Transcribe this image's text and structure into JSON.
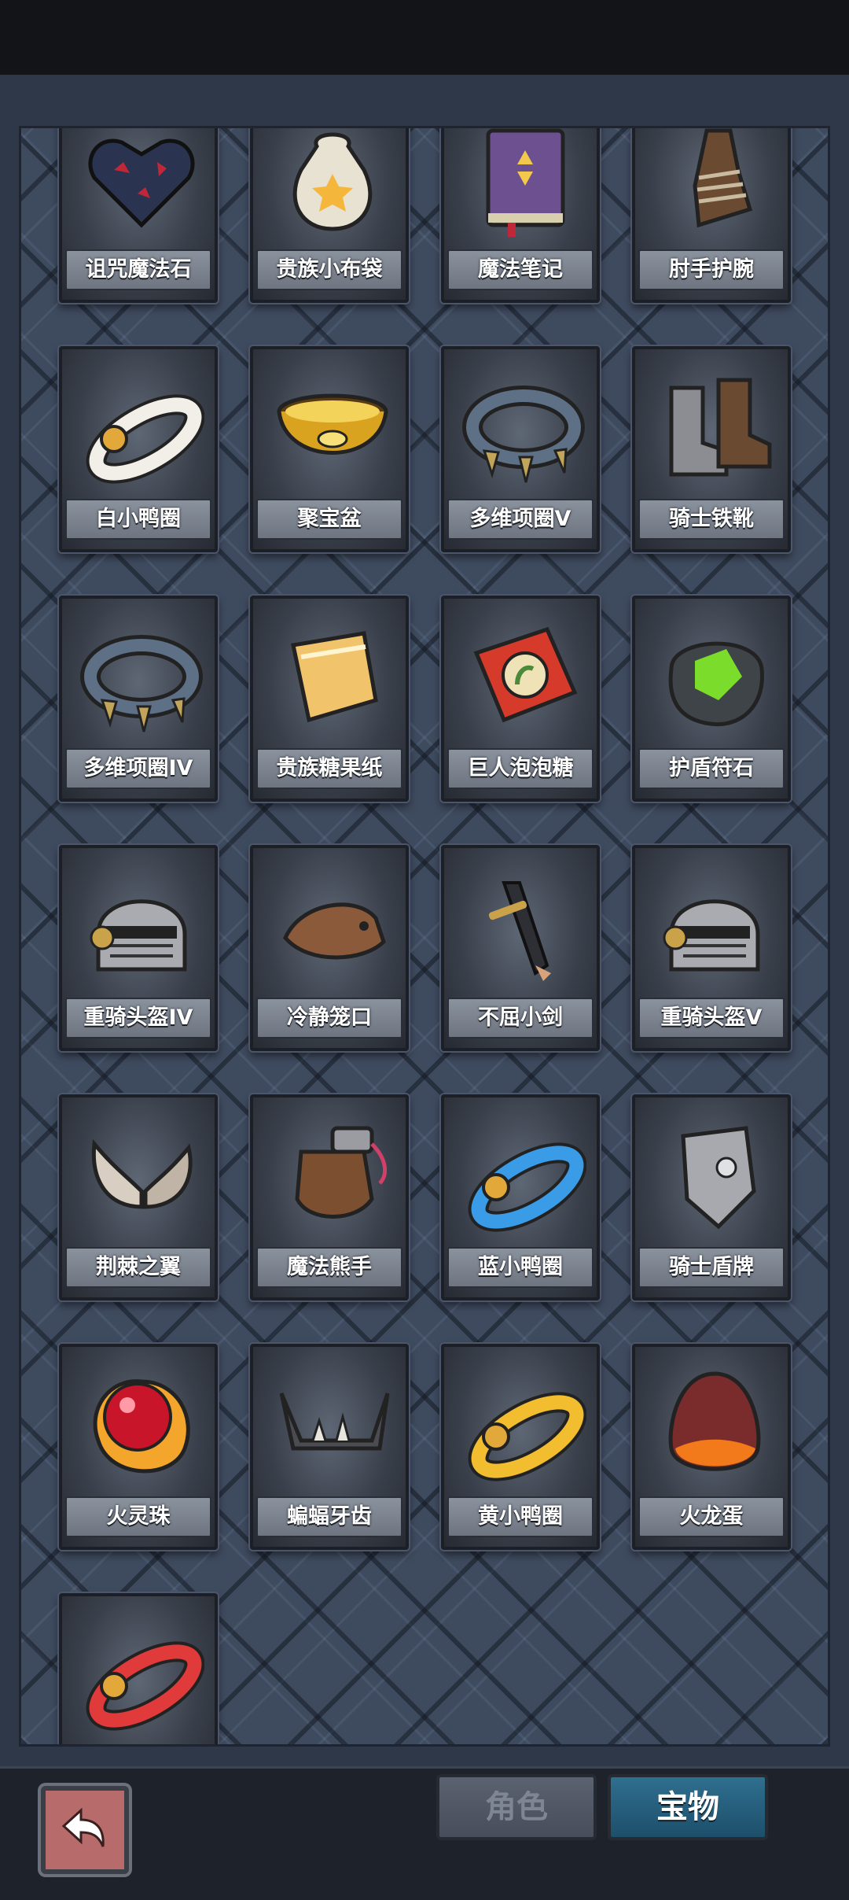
{
  "items": [
    {
      "name": "诅咒魔法石",
      "icon": "cursed-heart-stone-icon"
    },
    {
      "name": "贵族小布袋",
      "icon": "cloth-pouch-icon"
    },
    {
      "name": "魔法笔记",
      "icon": "magic-book-icon"
    },
    {
      "name": "肘手护腕",
      "icon": "wrist-guard-icon"
    },
    {
      "name": "白小鸭圈",
      "icon": "white-duck-ring-icon"
    },
    {
      "name": "聚宝盆",
      "icon": "treasure-bowl-icon"
    },
    {
      "name": "多维项圈V",
      "icon": "spiked-collar-icon"
    },
    {
      "name": "骑士铁靴",
      "icon": "iron-boots-icon"
    },
    {
      "name": "多维项圈IV",
      "icon": "spiked-collar-icon"
    },
    {
      "name": "贵族糖果纸",
      "icon": "candy-wrapper-icon"
    },
    {
      "name": "巨人泡泡糖",
      "icon": "bubble-gum-box-icon"
    },
    {
      "name": "护盾符石",
      "icon": "shield-rune-stone-icon"
    },
    {
      "name": "重骑头盔IV",
      "icon": "knight-helmet-icon"
    },
    {
      "name": "冷静笼口",
      "icon": "muzzle-icon"
    },
    {
      "name": "不屈小剑",
      "icon": "short-sword-icon"
    },
    {
      "name": "重骑头盔V",
      "icon": "knight-helmet-icon"
    },
    {
      "name": "荆棘之翼",
      "icon": "thorn-wings-icon"
    },
    {
      "name": "魔法熊手",
      "icon": "bear-paw-icon"
    },
    {
      "name": "蓝小鸭圈",
      "icon": "blue-duck-ring-icon"
    },
    {
      "name": "骑士盾牌",
      "icon": "knight-shield-icon"
    },
    {
      "name": "火灵珠",
      "icon": "fire-orb-icon"
    },
    {
      "name": "蝙蝠牙齿",
      "icon": "bat-teeth-icon"
    },
    {
      "name": "黄小鸭圈",
      "icon": "yellow-duck-ring-icon"
    },
    {
      "name": "火龙蛋",
      "icon": "dragon-egg-icon"
    },
    {
      "name": "",
      "icon": "red-duck-ring-icon"
    }
  ],
  "tabs": {
    "role": "角色",
    "treasure": "宝物",
    "active": "treasure"
  },
  "back_icon": "back-arrow-icon"
}
